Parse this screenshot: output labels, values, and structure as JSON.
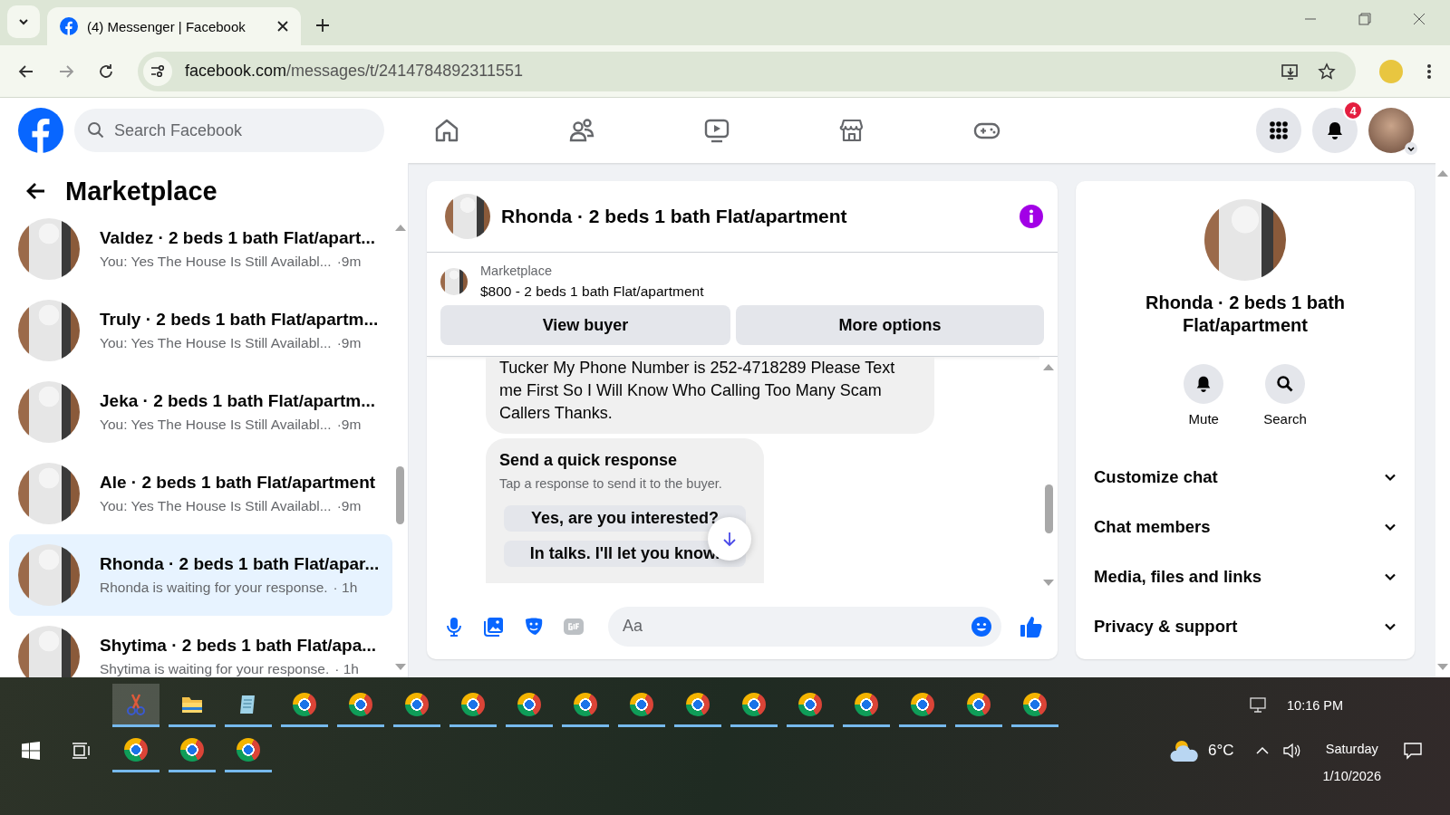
{
  "browser": {
    "tab": {
      "title": "(4) Messenger | Facebook",
      "selected": true
    },
    "url_host": "facebook.com",
    "url_path": "/messages/t/2414784892311551"
  },
  "header": {
    "search_placeholder": "Search Facebook",
    "notification_count": "4"
  },
  "sidebar": {
    "title": "Marketplace",
    "conversations": [
      {
        "title": "Valdez · 2 beds 1 bath Flat/apart...",
        "preview": "You: Yes The House Is Still Availabl...",
        "time": "·9m",
        "selected": false
      },
      {
        "title": "Truly · 2 beds 1 bath Flat/apartm...",
        "preview": "You: Yes The House Is Still Availabl...",
        "time": "·9m",
        "selected": false
      },
      {
        "title": "Jeka · 2 beds 1 bath Flat/apartm...",
        "preview": "You: Yes The House Is Still Availabl...",
        "time": "·9m",
        "selected": false
      },
      {
        "title": "Ale · 2 beds 1 bath Flat/apartment",
        "preview": "You: Yes The House Is Still Availabl...",
        "time": "·9m",
        "selected": false
      },
      {
        "title": "Rhonda · 2 beds 1 bath Flat/apar...",
        "preview": "Rhonda is waiting for your response.",
        "time": "· 1h",
        "selected": true
      },
      {
        "title": "Shytima · 2 beds 1 bath Flat/apa...",
        "preview": "Shytima is waiting for your response.",
        "time": "· 1h",
        "selected": false
      }
    ]
  },
  "chat": {
    "title": "Rhonda · 2 beds 1 bath Flat/apartment",
    "listing": {
      "label": "Marketplace",
      "price_line": "$800 - 2 beds 1 bath Flat/apartment"
    },
    "buttons": [
      "View buyer",
      "More options"
    ],
    "message": "Tucker My Phone Number is 252-4718289 Please Text me First So I Will Know Who Calling Too Many Scam Callers Thanks.",
    "quick_response": {
      "title": "Send a quick response",
      "hint": "Tap a response to send it to the buyer.",
      "options": [
        "Yes, are you interested?",
        "In talks. I'll let you know."
      ]
    },
    "composer_placeholder": "Aa"
  },
  "details": {
    "title": "Rhonda · 2 beds 1 bath Flat/apartment",
    "actions": [
      {
        "label": "Mute",
        "kind": "bell"
      },
      {
        "label": "Search",
        "kind": "search"
      }
    ],
    "sections": [
      "Customize chat",
      "Chat members",
      "Media, files and links",
      "Privacy & support"
    ]
  },
  "taskbar": {
    "apps_row_1": [
      {
        "kind": "snip",
        "selected": true
      },
      {
        "kind": "folder",
        "selected": false
      },
      {
        "kind": "notepad",
        "selected": false
      },
      {
        "kind": "chrome",
        "selected": false
      },
      {
        "kind": "chrome",
        "selected": false
      },
      {
        "kind": "chrome",
        "selected": false
      },
      {
        "kind": "chrome",
        "selected": false
      },
      {
        "kind": "chrome",
        "selected": false
      },
      {
        "kind": "chrome",
        "selected": false
      },
      {
        "kind": "chrome",
        "selected": false
      },
      {
        "kind": "chrome",
        "selected": false
      },
      {
        "kind": "chrome",
        "selected": false
      },
      {
        "kind": "chrome",
        "selected": false
      },
      {
        "kind": "chrome",
        "selected": false
      },
      {
        "kind": "chrome",
        "selected": false
      },
      {
        "kind": "chrome",
        "selected": false
      },
      {
        "kind": "chrome",
        "selected": false
      }
    ],
    "apps_row_2": [
      {
        "kind": "chrome",
        "selected": false
      },
      {
        "kind": "chrome",
        "selected": false
      },
      {
        "kind": "chrome",
        "selected": false
      }
    ],
    "temperature": "6°C",
    "time": "10:16 PM",
    "day": "Saturday",
    "date": "1/10/2026"
  }
}
